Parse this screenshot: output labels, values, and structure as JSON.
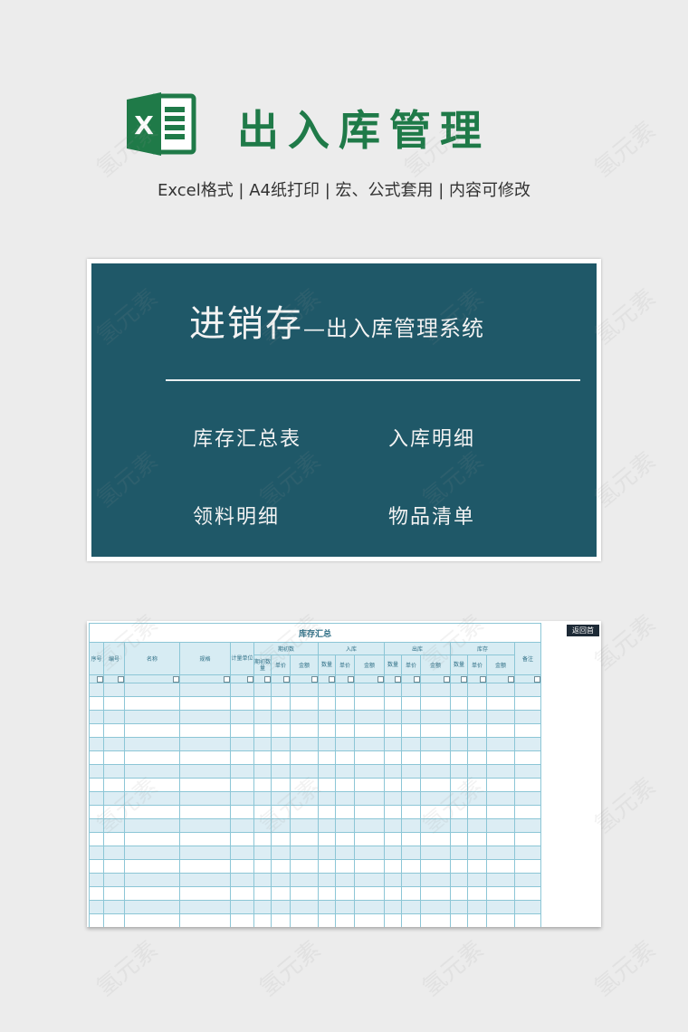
{
  "header": {
    "title": "出入库管理",
    "subtitle": "Excel格式 |  A4纸打印 | 宏、公式套用 | 内容可修改",
    "logo_letter": "X",
    "logo_color": "#1f7a48"
  },
  "menu": {
    "title_big": "进销存",
    "title_small": "—出入库管理系统",
    "bg_color": "#1f5868",
    "items": [
      {
        "label": "库存汇总表"
      },
      {
        "label": "入库明细"
      },
      {
        "label": "领料明细"
      },
      {
        "label": "物品清单"
      }
    ]
  },
  "sheet": {
    "title": "库存汇总",
    "back_button": "返回首",
    "columns": {
      "seq": "序号",
      "code": "编号",
      "name": "名称",
      "spec": "规格",
      "unit": "计量单位",
      "opening": "期初数",
      "opening_sub": [
        "期初数量",
        "单价",
        "金额"
      ],
      "inbound": "入库",
      "inbound_sub": [
        "数量",
        "单价",
        "金额"
      ],
      "outbound": "出库",
      "outbound_sub": [
        "数量",
        "单价",
        "金额"
      ],
      "stock": "库存",
      "stock_sub": [
        "数量",
        "单价",
        "金额"
      ],
      "remark": "备注"
    },
    "accent_color": "#8cc6d6"
  },
  "watermark": "氢元素"
}
